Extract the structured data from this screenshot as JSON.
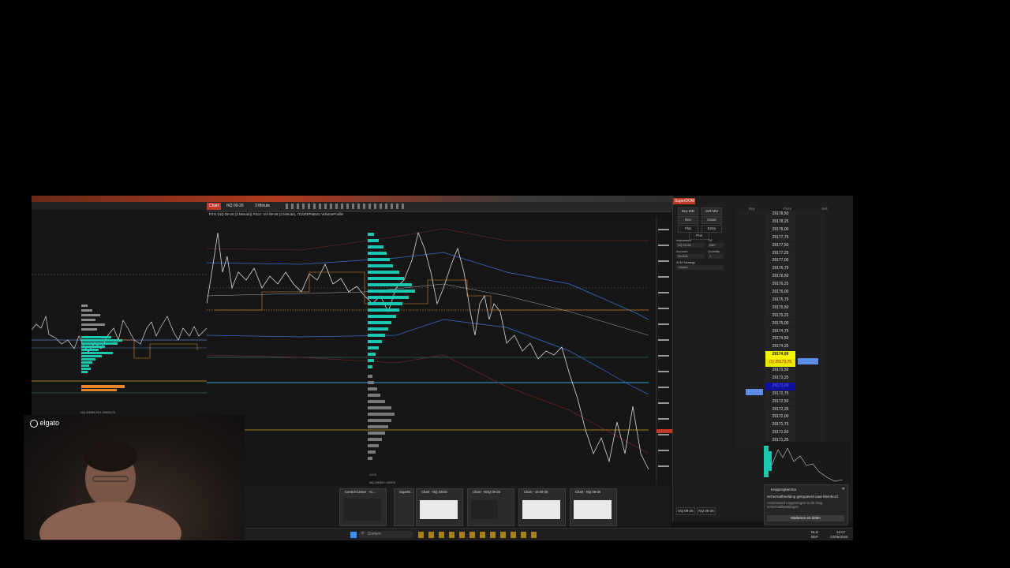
{
  "overlay": {
    "webcam_brand": "elgato"
  },
  "left_chart": {
    "footer": "NQ 29089,25 ▪ 29029,75"
  },
  "main_chart": {
    "tabs": [
      {
        "label": "Chart"
      },
      {
        "label": "NQ 09-26"
      },
      {
        "label": "3 Minute"
      }
    ],
    "subtitle": "RTH (NQ 09-26 (3 Minute)) Price: Vol 09-26 (3 Minute), 7/1/2/3/Pattern VolumeProfile",
    "footer_left": "1:0:0",
    "footer_right": "NQ 29093 ▪ 29070"
  },
  "dom": {
    "title": "SuperDOM",
    "buttons": {
      "buy_mkt": "Buy Mkt",
      "sell_mkt": "Sell Mkt",
      "rev": "Rev",
      "close": "Close",
      "flat": "Flat",
      "entry": "Entry",
      "pos": "Pos"
    },
    "labels": {
      "instrument": "Instrument",
      "tif": "TIF",
      "account": "Account",
      "quantity": "Quantity",
      "atm": "ATM Strategy"
    },
    "fields": {
      "instrument": "NQ 09-26",
      "tif": "DAY",
      "account": "Sim101",
      "quantity": "1",
      "atm": "<None>"
    },
    "col_headers": {
      "buy": "Buy",
      "price": "Price",
      "sell": "Sell"
    },
    "prices": [
      "29178,50",
      "29178,25",
      "29178,00",
      "29177,75",
      "29177,50",
      "29177,25",
      "29177,00",
      "29176,75",
      "29176,50",
      "29176,25",
      "29176,00",
      "29175,75",
      "29175,50",
      "29175,25",
      "29175,00",
      "29174,75",
      "29174,50",
      "29174,25",
      "29174,00",
      "(1) 29173,75",
      "29173,50",
      "29173,25",
      "29173,00",
      "29172,75",
      "29172,50",
      "29172,25",
      "29172,00",
      "29171,75",
      "29171,50",
      "29171,25"
    ],
    "last_price_index": 18,
    "position_index": 19,
    "bid_index": 22,
    "bottom_tabs": [
      "NQ 09-26",
      "NQ 09-26"
    ]
  },
  "thumbnails": [
    {
      "title": "Control Center - Ac..."
    },
    {
      "title": "SuperD..."
    },
    {
      "title": "Chart - NQ 30min"
    },
    {
      "title": "Chart - NSQ 09-26"
    },
    {
      "title": "Chart - 15 09-26"
    },
    {
      "title": "Chart - NQ 09-26"
    }
  ],
  "toast": {
    "app": "Knipprogramma",
    "message": "Schermafbeelding gekopieerd naar klembord",
    "detail": "Automatisch opgeslagen in de map schermafbeeldingen",
    "button": "Markeren en delen"
  },
  "taskbar": {
    "search_placeholder": "Zoeken",
    "tray_lang": "NLD",
    "tray_layout": "BEP",
    "time": "12:07",
    "date": "24/06/2026"
  },
  "colors": {
    "accent_red": "#c0392b",
    "teal_profile": "#1ec8b0",
    "orange_level": "#e8872a",
    "blue_band": "#3a6fd8",
    "last_price": "#f4f400"
  }
}
